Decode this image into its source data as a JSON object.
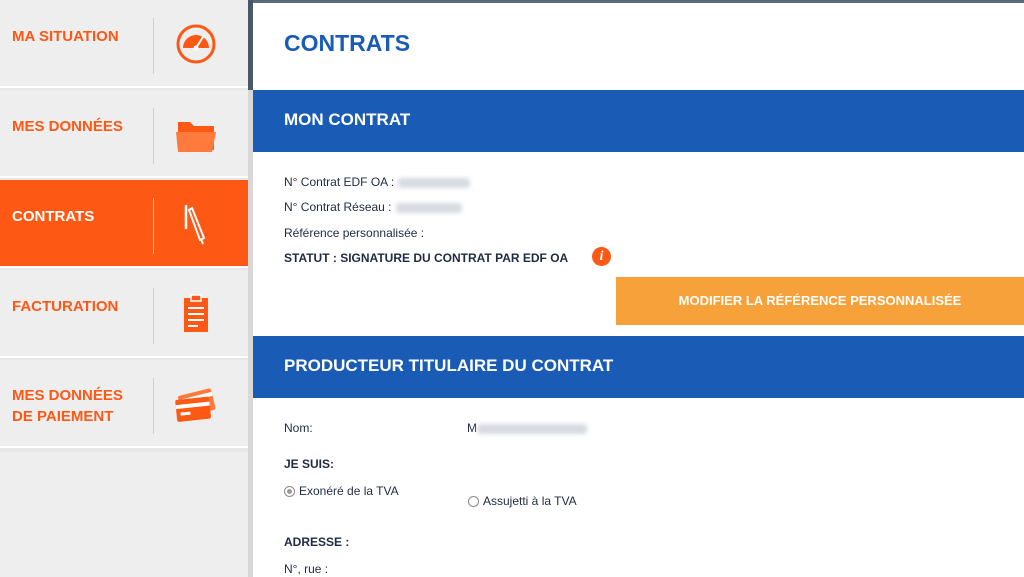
{
  "sidebar": {
    "items": [
      {
        "label": "MA SITUATION",
        "icon": "gauge-icon"
      },
      {
        "label": "MES DONNÉES",
        "icon": "folder-icon"
      },
      {
        "label": "CONTRATS",
        "icon": "pen-icon",
        "active": true
      },
      {
        "label": "FACTURATION",
        "icon": "clipboard-icon"
      },
      {
        "label_line1": "MES DONNÉES",
        "label_line2": "DE PAIEMENT",
        "icon": "credit-cards-icon"
      }
    ]
  },
  "main": {
    "title": "CONTRATS",
    "mon_contrat": {
      "heading": "MON CONTRAT",
      "contrat_edf_oa_label": "N° Contrat EDF OA :",
      "contrat_reseau_label": "N° Contrat Réseau :",
      "reference_label": "Référence personnalisée :",
      "statut": "STATUT : SIGNATURE DU CONTRAT PAR EDF OA",
      "modify_button": "MODIFIER LA RÉFÉRENCE PERSONNALISÉE"
    },
    "producteur": {
      "heading": "PRODUCTEUR TITULAIRE DU CONTRAT",
      "nom_label": "Nom:",
      "nom_value_initial": "M",
      "je_suis_label": "JE SUIS:",
      "radio_exonere": "Exonéré de la TVA",
      "radio_assujetti": "Assujetti à la TVA",
      "selected": "exonere",
      "adresse_label": "ADRESSE :",
      "rue_label": "N°, rue :"
    }
  },
  "colors": {
    "accent_orange": "#fe5815",
    "button_orange": "#f7a13a",
    "brand_blue": "#1a5cb5",
    "text_dark": "#1e2b44"
  }
}
